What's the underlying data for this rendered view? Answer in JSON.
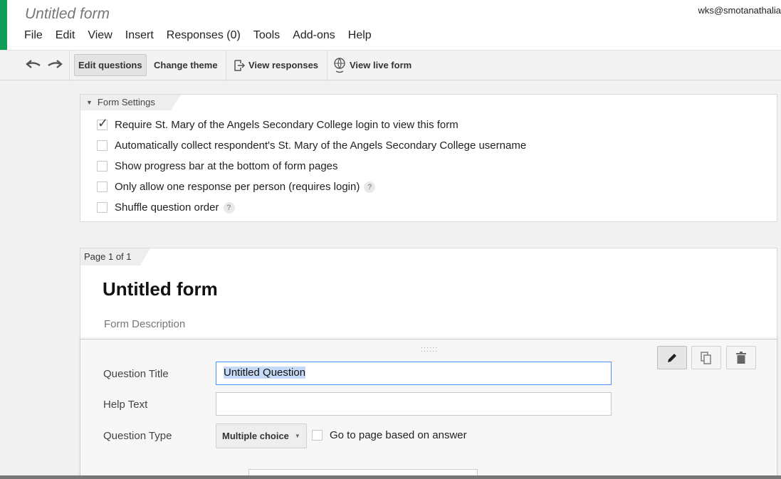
{
  "header": {
    "doc_title": "Untitled form",
    "user": "wks@smotanathalia",
    "menu": [
      "File",
      "Edit",
      "View",
      "Insert",
      "Responses (0)",
      "Tools",
      "Add-ons",
      "Help"
    ]
  },
  "toolbar": {
    "undo_icon": "undo-icon",
    "redo_icon": "redo-icon",
    "edit_questions": "Edit questions",
    "change_theme": "Change theme",
    "view_responses": "View responses",
    "view_live_form": "View live form"
  },
  "settings": {
    "title": "Form Settings",
    "options": [
      {
        "label": "Require St. Mary of the Angels Secondary College login to view this form",
        "checked": true,
        "help": false
      },
      {
        "label": "Automatically collect respondent's St. Mary of the Angels Secondary College username",
        "checked": false,
        "help": false
      },
      {
        "label": "Show progress bar at the bottom of form pages",
        "checked": false,
        "help": false
      },
      {
        "label": "Only allow one response per person (requires login)",
        "checked": false,
        "help": true
      },
      {
        "label": "Shuffle question order",
        "checked": false,
        "help": true
      }
    ],
    "help_glyph": "?"
  },
  "page": {
    "tab": "Page 1 of 1",
    "form_title": "Untitled form",
    "form_description": "Form Description"
  },
  "question": {
    "title_label": "Question Title",
    "title_value": "Untitled Question",
    "help_label": "Help Text",
    "help_value": "",
    "type_label": "Question Type",
    "type_value": "Multiple choice",
    "goto_label": "Go to page based on answer"
  }
}
